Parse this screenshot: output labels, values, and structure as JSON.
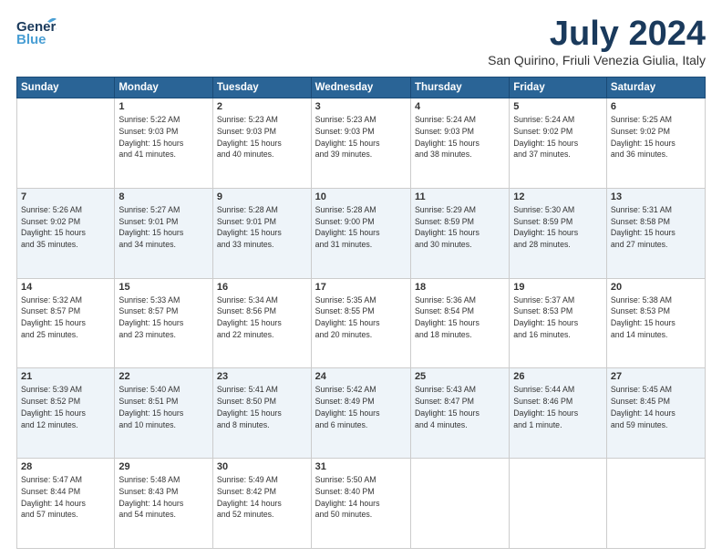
{
  "logo": {
    "line1": "General",
    "line2": "Blue"
  },
  "title": {
    "month_year": "July 2024",
    "location": "San Quirino, Friuli Venezia Giulia, Italy"
  },
  "headers": [
    "Sunday",
    "Monday",
    "Tuesday",
    "Wednesday",
    "Thursday",
    "Friday",
    "Saturday"
  ],
  "weeks": [
    [
      {
        "day": "",
        "info": ""
      },
      {
        "day": "1",
        "info": "Sunrise: 5:22 AM\nSunset: 9:03 PM\nDaylight: 15 hours\nand 41 minutes."
      },
      {
        "day": "2",
        "info": "Sunrise: 5:23 AM\nSunset: 9:03 PM\nDaylight: 15 hours\nand 40 minutes."
      },
      {
        "day": "3",
        "info": "Sunrise: 5:23 AM\nSunset: 9:03 PM\nDaylight: 15 hours\nand 39 minutes."
      },
      {
        "day": "4",
        "info": "Sunrise: 5:24 AM\nSunset: 9:03 PM\nDaylight: 15 hours\nand 38 minutes."
      },
      {
        "day": "5",
        "info": "Sunrise: 5:24 AM\nSunset: 9:02 PM\nDaylight: 15 hours\nand 37 minutes."
      },
      {
        "day": "6",
        "info": "Sunrise: 5:25 AM\nSunset: 9:02 PM\nDaylight: 15 hours\nand 36 minutes."
      }
    ],
    [
      {
        "day": "7",
        "info": "Sunrise: 5:26 AM\nSunset: 9:02 PM\nDaylight: 15 hours\nand 35 minutes."
      },
      {
        "day": "8",
        "info": "Sunrise: 5:27 AM\nSunset: 9:01 PM\nDaylight: 15 hours\nand 34 minutes."
      },
      {
        "day": "9",
        "info": "Sunrise: 5:28 AM\nSunset: 9:01 PM\nDaylight: 15 hours\nand 33 minutes."
      },
      {
        "day": "10",
        "info": "Sunrise: 5:28 AM\nSunset: 9:00 PM\nDaylight: 15 hours\nand 31 minutes."
      },
      {
        "day": "11",
        "info": "Sunrise: 5:29 AM\nSunset: 8:59 PM\nDaylight: 15 hours\nand 30 minutes."
      },
      {
        "day": "12",
        "info": "Sunrise: 5:30 AM\nSunset: 8:59 PM\nDaylight: 15 hours\nand 28 minutes."
      },
      {
        "day": "13",
        "info": "Sunrise: 5:31 AM\nSunset: 8:58 PM\nDaylight: 15 hours\nand 27 minutes."
      }
    ],
    [
      {
        "day": "14",
        "info": "Sunrise: 5:32 AM\nSunset: 8:57 PM\nDaylight: 15 hours\nand 25 minutes."
      },
      {
        "day": "15",
        "info": "Sunrise: 5:33 AM\nSunset: 8:57 PM\nDaylight: 15 hours\nand 23 minutes."
      },
      {
        "day": "16",
        "info": "Sunrise: 5:34 AM\nSunset: 8:56 PM\nDaylight: 15 hours\nand 22 minutes."
      },
      {
        "day": "17",
        "info": "Sunrise: 5:35 AM\nSunset: 8:55 PM\nDaylight: 15 hours\nand 20 minutes."
      },
      {
        "day": "18",
        "info": "Sunrise: 5:36 AM\nSunset: 8:54 PM\nDaylight: 15 hours\nand 18 minutes."
      },
      {
        "day": "19",
        "info": "Sunrise: 5:37 AM\nSunset: 8:53 PM\nDaylight: 15 hours\nand 16 minutes."
      },
      {
        "day": "20",
        "info": "Sunrise: 5:38 AM\nSunset: 8:53 PM\nDaylight: 15 hours\nand 14 minutes."
      }
    ],
    [
      {
        "day": "21",
        "info": "Sunrise: 5:39 AM\nSunset: 8:52 PM\nDaylight: 15 hours\nand 12 minutes."
      },
      {
        "day": "22",
        "info": "Sunrise: 5:40 AM\nSunset: 8:51 PM\nDaylight: 15 hours\nand 10 minutes."
      },
      {
        "day": "23",
        "info": "Sunrise: 5:41 AM\nSunset: 8:50 PM\nDaylight: 15 hours\nand 8 minutes."
      },
      {
        "day": "24",
        "info": "Sunrise: 5:42 AM\nSunset: 8:49 PM\nDaylight: 15 hours\nand 6 minutes."
      },
      {
        "day": "25",
        "info": "Sunrise: 5:43 AM\nSunset: 8:47 PM\nDaylight: 15 hours\nand 4 minutes."
      },
      {
        "day": "26",
        "info": "Sunrise: 5:44 AM\nSunset: 8:46 PM\nDaylight: 15 hours\nand 1 minute."
      },
      {
        "day": "27",
        "info": "Sunrise: 5:45 AM\nSunset: 8:45 PM\nDaylight: 14 hours\nand 59 minutes."
      }
    ],
    [
      {
        "day": "28",
        "info": "Sunrise: 5:47 AM\nSunset: 8:44 PM\nDaylight: 14 hours\nand 57 minutes."
      },
      {
        "day": "29",
        "info": "Sunrise: 5:48 AM\nSunset: 8:43 PM\nDaylight: 14 hours\nand 54 minutes."
      },
      {
        "day": "30",
        "info": "Sunrise: 5:49 AM\nSunset: 8:42 PM\nDaylight: 14 hours\nand 52 minutes."
      },
      {
        "day": "31",
        "info": "Sunrise: 5:50 AM\nSunset: 8:40 PM\nDaylight: 14 hours\nand 50 minutes."
      },
      {
        "day": "",
        "info": ""
      },
      {
        "day": "",
        "info": ""
      },
      {
        "day": "",
        "info": ""
      }
    ]
  ]
}
